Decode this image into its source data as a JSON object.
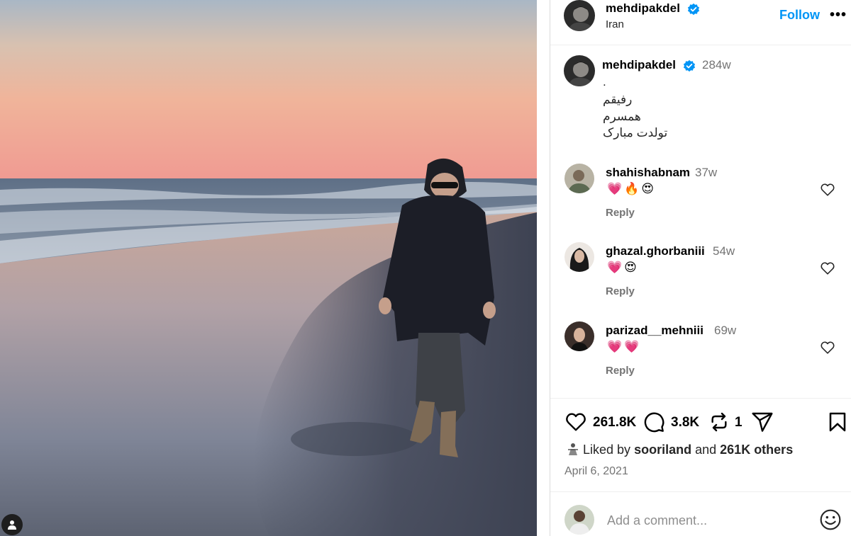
{
  "post": {
    "username": "mehdipakdel",
    "location": "Iran",
    "follow_label": "Follow",
    "more_label": "•••"
  },
  "caption": {
    "username": "mehdipakdel",
    "time": "284w",
    "lines": [
      ".",
      "رفیقم",
      "همسرم",
      "تولدت مبارک"
    ]
  },
  "comments": [
    {
      "username": "shahishabnam",
      "time": "37w",
      "emojis": "💗🔥😍",
      "reply": "Reply"
    },
    {
      "username": "ghazal.ghorbaniii",
      "time": "54w",
      "emojis": "💗😍",
      "reply": "Reply"
    },
    {
      "username": "parizad__mehniii",
      "time": "69w",
      "emojis": "💗💗",
      "reply": "Reply"
    }
  ],
  "actions": {
    "likes": "261.8K",
    "comments": "3.8K",
    "reposts": "1"
  },
  "liked_by": {
    "prefix": "Liked by",
    "user": "sooriland",
    "connector": "and",
    "others": "261K others"
  },
  "date": "April 6, 2021",
  "comment_input": {
    "placeholder": "Add a comment..."
  },
  "colors": {
    "accent": "#0095f6",
    "verified": "#0095f6",
    "muted": "#737373"
  },
  "icons": [
    "verified-badge-icon",
    "heart-icon",
    "comment-icon",
    "repost-icon",
    "share-icon",
    "bookmark-icon",
    "emoji-icon",
    "person-tag-icon"
  ]
}
